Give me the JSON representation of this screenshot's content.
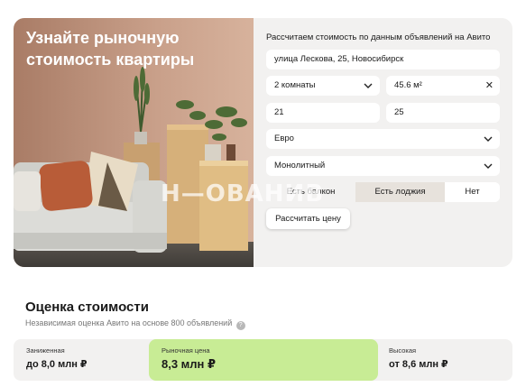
{
  "hero": {
    "title": "Узнайте рыночную стоимость квартиры"
  },
  "form": {
    "title": "Рассчитаем стоимость по данным объявлений на Авито",
    "address": "улица Лескова, 25, Новосибирск",
    "rooms": "2 комнаты",
    "area": "45.6 м²",
    "floor": "21",
    "floors_total": "25",
    "renovation": "Евро",
    "house_type": "Монолитный",
    "balcony_options": [
      "Есть балкон",
      "Есть лоджия",
      "Нет"
    ],
    "balcony_selected": "Есть лоджия",
    "calc_button": "Рассчитать цену"
  },
  "watermark": "Н—ОВАНИВ",
  "estimate": {
    "title": "Оценка стоимости",
    "subtitle": "Независимая оценка Авито на основе 800 объявлений",
    "help": "?",
    "low_label": "Заниженная",
    "low_value": "до 8,0 млн ₽",
    "market_label": "Рыночная цена",
    "market_value": "8,3 млн ₽",
    "high_label": "Высокая",
    "high_value": "от 8,6 млн ₽"
  },
  "colors": {
    "accent_green": "#c8ec95",
    "panel": "#f2f1f0",
    "wall": "#c49a82"
  }
}
